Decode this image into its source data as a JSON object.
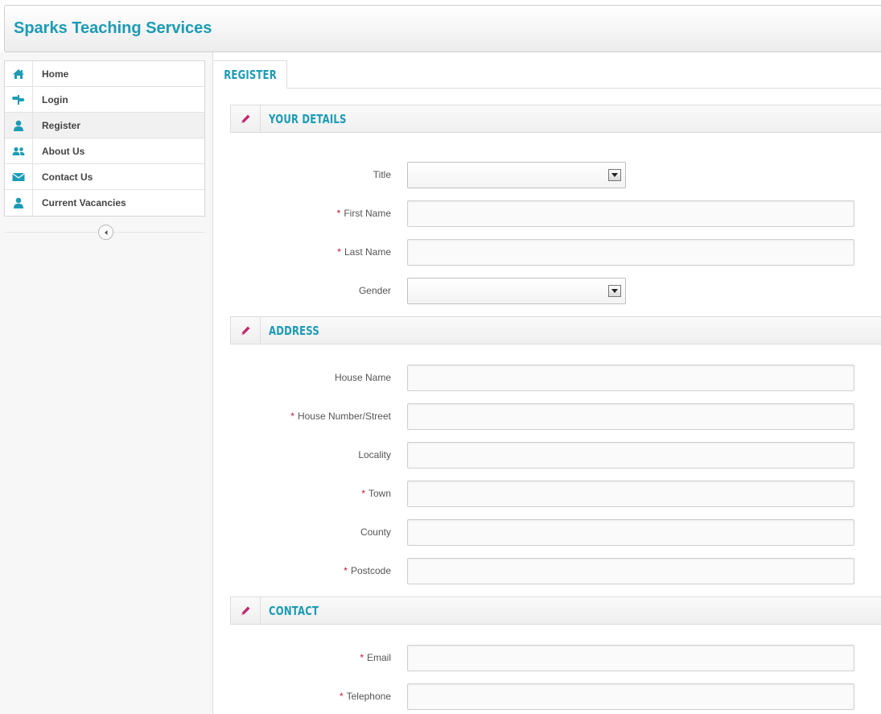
{
  "header": {
    "brand": "Sparks Teaching Services"
  },
  "nav": {
    "items": [
      {
        "label": "Home",
        "icon": "home-icon"
      },
      {
        "label": "Login",
        "icon": "signpost-icon"
      },
      {
        "label": "Register",
        "icon": "user-icon",
        "active": true
      },
      {
        "label": "About Us",
        "icon": "users-icon"
      },
      {
        "label": "Contact Us",
        "icon": "envelope-icon"
      },
      {
        "label": "Current Vacancies",
        "icon": "user-icon"
      }
    ]
  },
  "tab": {
    "label": "Register"
  },
  "sections": {
    "details": {
      "title": "Your Details"
    },
    "address": {
      "title": "Address"
    },
    "contact": {
      "title": "Contact"
    }
  },
  "fields": {
    "title": {
      "label": "Title",
      "required": false,
      "value": ""
    },
    "first_name": {
      "label": "First Name",
      "required": true,
      "value": ""
    },
    "last_name": {
      "label": "Last Name",
      "required": true,
      "value": ""
    },
    "gender": {
      "label": "Gender",
      "required": false,
      "value": ""
    },
    "house_name": {
      "label": "House Name",
      "required": false,
      "value": ""
    },
    "house_number_street": {
      "label": "House Number/Street",
      "required": true,
      "value": ""
    },
    "locality": {
      "label": "Locality",
      "required": false,
      "value": ""
    },
    "town": {
      "label": "Town",
      "required": true,
      "value": ""
    },
    "county": {
      "label": "County",
      "required": false,
      "value": ""
    },
    "postcode": {
      "label": "Postcode",
      "required": true,
      "value": ""
    },
    "email": {
      "label": "Email",
      "required": true,
      "value": ""
    },
    "telephone": {
      "label": "Telephone",
      "required": true,
      "value": ""
    }
  },
  "required_marker": "*",
  "colors": {
    "accent": "#1c9bb5",
    "required": "#c8102e",
    "pencil": "#c0266f"
  }
}
